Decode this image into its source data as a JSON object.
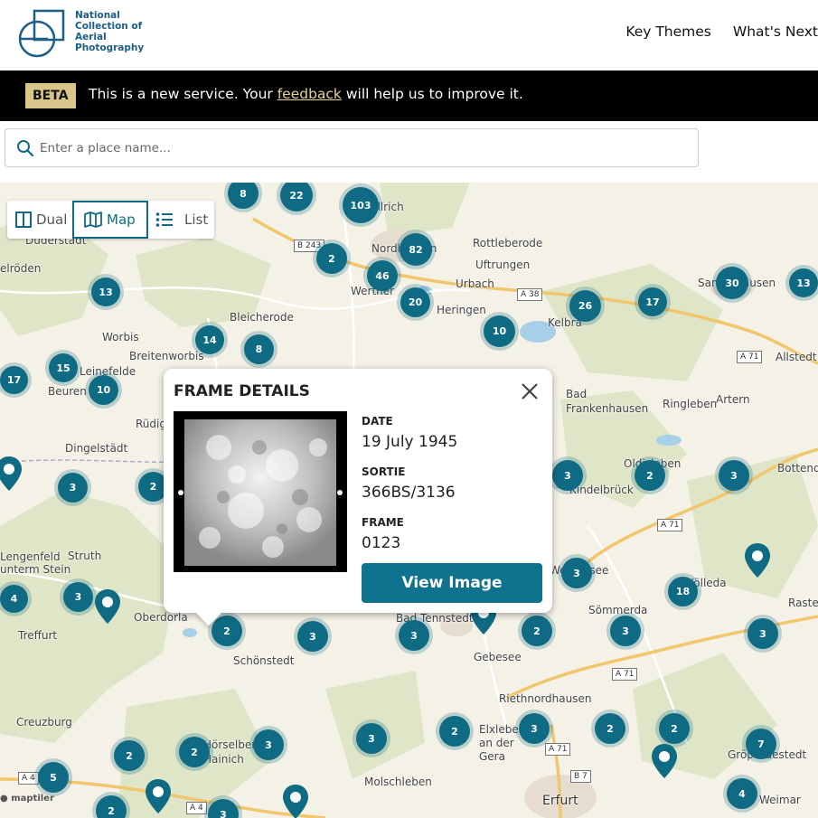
{
  "header": {
    "logo_text": "National Collection of Aerial Photography",
    "nav": [
      "Key Themes",
      "What's Next"
    ]
  },
  "beta": {
    "badge": "BETA",
    "text_before": "This is a new service. Your ",
    "link": "feedback",
    "text_after": " will help us to improve it."
  },
  "search": {
    "placeholder": "Enter a place name..."
  },
  "view_toggle": {
    "dual": "Dual",
    "map": "Map",
    "list": "List",
    "active": "Map"
  },
  "map": {
    "attribution": "maptiler",
    "places": [
      "Duderstadt",
      "elröden",
      "Worbis",
      "Breitenworbis",
      "Bleicherode",
      "Nordhausen",
      "Rottleberode",
      "Uftrungen",
      "Urbach",
      "Heringen",
      "Werther",
      "Kelbra",
      "Sangerhausen",
      "Allstedt",
      "Artern",
      "Bad Frankenhausen",
      "Ringleben",
      "Beuren",
      "Leinefelde",
      "Rüdig",
      "Dingelstädt",
      "Oldisleben",
      "Kindelbrück",
      "Lengenfeld unterm Stein",
      "Struth",
      "Oberdorla",
      "Treffurt",
      "Schönstedt",
      "Bad Tennstedt",
      "Gebesee",
      "Sömmerda",
      "Kölleda",
      "Rastenberg",
      "Riethnordhausen",
      "Elxleben an der Gera",
      "Creuzburg",
      "Hörselberg-Hainich",
      "Molschleben",
      "Erfurt",
      "Gröβrudestedt",
      "Weimar",
      "Ellrich",
      "Bottendorf",
      "Weißensee"
    ],
    "roads": [
      "B 243",
      "A 38",
      "A 71",
      "A 71",
      "A 71",
      "A 71",
      "B 7",
      "A 4",
      "A 4"
    ],
    "clusters": [
      "8",
      "22",
      "103",
      "2",
      "82",
      "46",
      "20",
      "13",
      "10",
      "26",
      "17",
      "30",
      "13",
      "14",
      "8",
      "15",
      "17",
      "10",
      "3",
      "2",
      "3",
      "2",
      "3",
      "18",
      "3",
      "4",
      "3",
      "2",
      "3",
      "3",
      "2",
      "3",
      "3",
      "2",
      "3",
      "2",
      "2",
      "7",
      "2",
      "2",
      "3",
      "5",
      "2",
      "3",
      "4"
    ]
  },
  "popup": {
    "title": "FRAME DETAILS",
    "date_label": "DATE",
    "date_value": "19 July 1945",
    "sortie_label": "SORTIE",
    "sortie_value": "366BS/3136",
    "frame_label": "FRAME",
    "frame_value": "0123",
    "button": "View Image"
  },
  "colors": {
    "brand": "#0f6b84",
    "beta_badge": "#d8c58a",
    "feedback_link": "#e6d48e"
  },
  "icons": [
    "logo-icon",
    "search-icon",
    "dual-view-icon",
    "map-icon",
    "list-icon",
    "close-icon",
    "map-pin-icon"
  ]
}
